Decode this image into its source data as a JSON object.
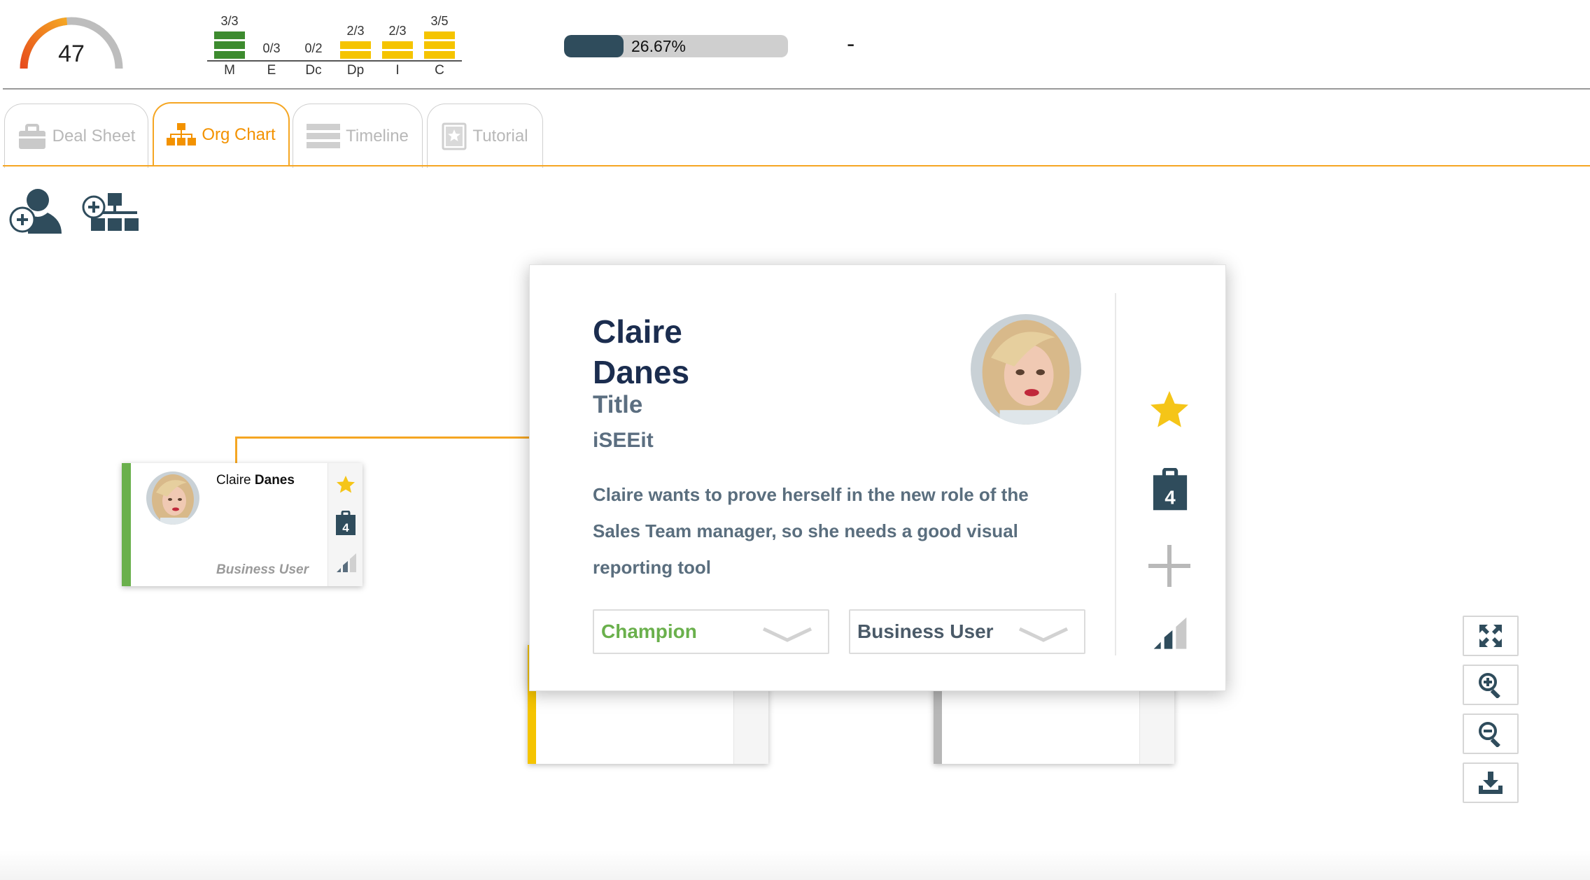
{
  "gauge": {
    "value": "47",
    "fraction": 0.47,
    "colors": {
      "fill_start": "#e74c1c",
      "fill_end": "#f5a623",
      "track": "#bdbdbd"
    }
  },
  "scores": [
    {
      "letter": "M",
      "fraction": "3/3",
      "filled": 3,
      "total": 3,
      "color": "#3d8b2f"
    },
    {
      "letter": "E",
      "fraction": "0/3",
      "filled": 0,
      "total": 3,
      "color": "#3d8b2f"
    },
    {
      "letter": "Dc",
      "fraction": "0/2",
      "filled": 0,
      "total": 2,
      "color": "#3d8b2f"
    },
    {
      "letter": "Dp",
      "fraction": "2/3",
      "filled": 2,
      "total": 3,
      "color": "#f5c400"
    },
    {
      "letter": "I",
      "fraction": "2/3",
      "filled": 2,
      "total": 3,
      "color": "#f5c400"
    },
    {
      "letter": "C",
      "fraction": "3/5",
      "filled": 3,
      "total": 5,
      "color": "#f5c400"
    }
  ],
  "progress": {
    "label": "26.67%",
    "value": 26.67,
    "fill_color": "#2f4c5c"
  },
  "dash": "-",
  "tabs": [
    {
      "id": "deal",
      "label": "Deal Sheet",
      "icon": "briefcase-icon",
      "active": false
    },
    {
      "id": "org",
      "label": "Org Chart",
      "icon": "org-chart-icon",
      "active": true
    },
    {
      "id": "timeline",
      "label": "Timeline",
      "icon": "timeline-icon",
      "active": false
    },
    {
      "id": "tutorial",
      "label": "Tutorial",
      "icon": "bookmark-star-icon",
      "active": false
    }
  ],
  "small_card": {
    "first_name": "Claire",
    "last_name": "Danes",
    "role": "Business User",
    "task_count": "4",
    "accent": "#6ab04c"
  },
  "popup": {
    "first_name": "Claire",
    "last_name": "Danes",
    "title": "Title",
    "company": "iSEEit",
    "description": "Claire wants to prove herself in the new role of the Sales Team manager, so she needs a good visual reporting tool",
    "task_count": "4",
    "relationship": {
      "value": "Champion",
      "color": "#6ab04c"
    },
    "role": {
      "value": "Business User",
      "color": "#4a5a68"
    }
  },
  "colors": {
    "accent_orange": "#f5a623",
    "star_yellow": "#f5c518",
    "icon_slate": "#2f4c5c"
  }
}
